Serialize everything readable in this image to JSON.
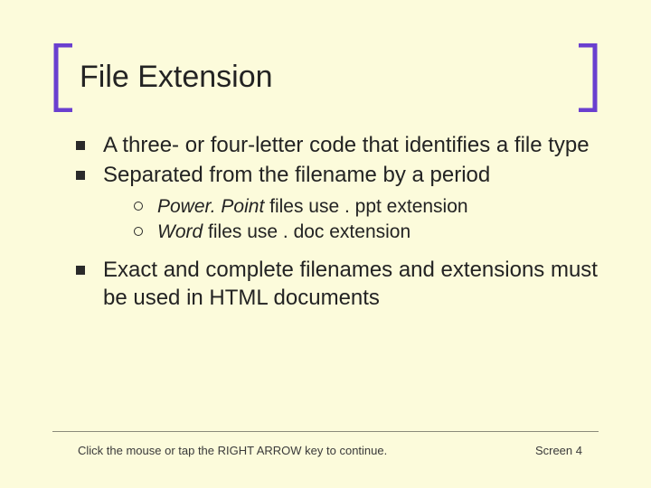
{
  "title": "File Extension",
  "bullets": [
    {
      "text": "A three- or four-letter code that identifies a file type"
    },
    {
      "text": "Separated from the filename by a period",
      "sub": [
        {
          "emph": "Power. Point",
          "rest": " files use . ppt extension"
        },
        {
          "emph": "Word",
          "rest": " files use . doc extension"
        }
      ]
    },
    {
      "text": "Exact and complete filenames and extensions must be used in HTML documents"
    }
  ],
  "footer": {
    "instruction": "Click the mouse or tap the RIGHT ARROW key to continue.",
    "screen_label": "Screen 4"
  },
  "colors": {
    "background": "#fcfbdb",
    "bracket": "#6a3fcf",
    "text": "#232323"
  }
}
